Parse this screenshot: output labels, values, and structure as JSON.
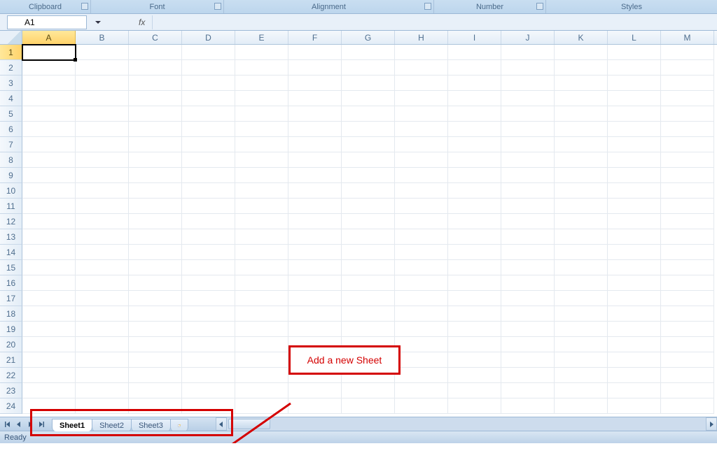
{
  "ribbon": {
    "groups": {
      "clipboard": "Clipboard",
      "font": "Font",
      "alignment": "Alignment",
      "number": "Number",
      "styles": "Styles"
    }
  },
  "nameBox": {
    "value": "A1"
  },
  "formulaBar": {
    "fxLabel": "fx",
    "value": ""
  },
  "columns": [
    "A",
    "B",
    "C",
    "D",
    "E",
    "F",
    "G",
    "H",
    "I",
    "J",
    "K",
    "L",
    "M"
  ],
  "rows": [
    1,
    2,
    3,
    4,
    5,
    6,
    7,
    8,
    9,
    10,
    11,
    12,
    13,
    14,
    15,
    16,
    17,
    18,
    19,
    20,
    21,
    22,
    23,
    24
  ],
  "activeCell": {
    "col": "A",
    "row": 1
  },
  "sheets": {
    "tabs": [
      {
        "name": "Sheet1",
        "active": true
      },
      {
        "name": "Sheet2",
        "active": false
      },
      {
        "name": "Sheet3",
        "active": false
      }
    ],
    "newSheetTooltip": "Insert Worksheet"
  },
  "status": {
    "text": "Ready"
  },
  "annotation": {
    "callout": "Add a new Sheet"
  }
}
